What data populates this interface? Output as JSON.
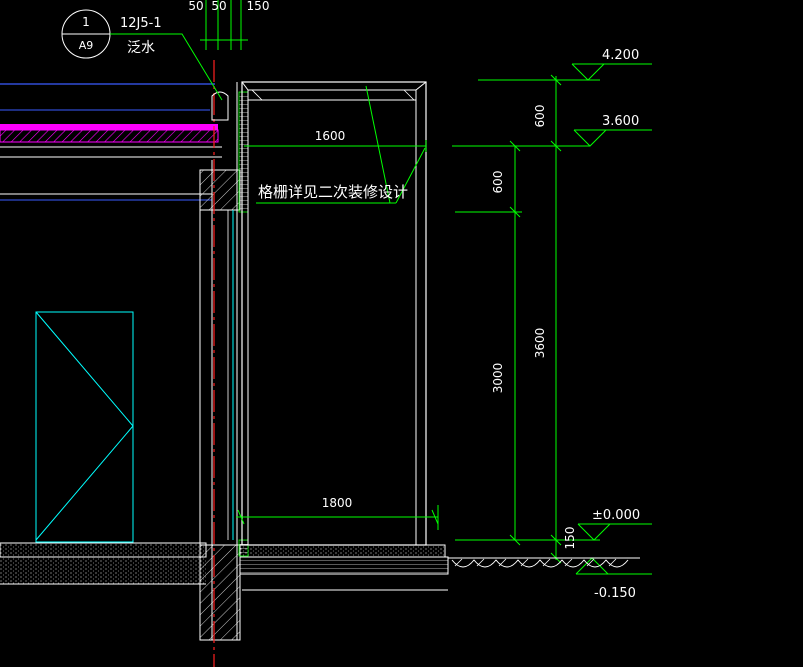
{
  "detail_callout": {
    "number": "1",
    "sheet": "A9",
    "reference": "12J5-1",
    "label": "泛水"
  },
  "top_dims": [
    "50",
    "50",
    "150"
  ],
  "annotations": {
    "grille_note": "格栅详见二次装修设计",
    "width_upper": "1600",
    "width_lower": "1800"
  },
  "dims_inner": [
    "600",
    "3000"
  ],
  "dims_outer": [
    "600",
    "3600",
    "150"
  ],
  "elevations": [
    "4.200",
    "3.600",
    "±0.000",
    "-0.150"
  ],
  "colors": {
    "background": "#000000",
    "line_white": "#ffffff",
    "line_green": "#00ff00",
    "line_cyan": "#00ffff",
    "line_blue": "#3a5bff",
    "line_red": "#ff2020",
    "fill_magenta": "#ff00ff"
  }
}
